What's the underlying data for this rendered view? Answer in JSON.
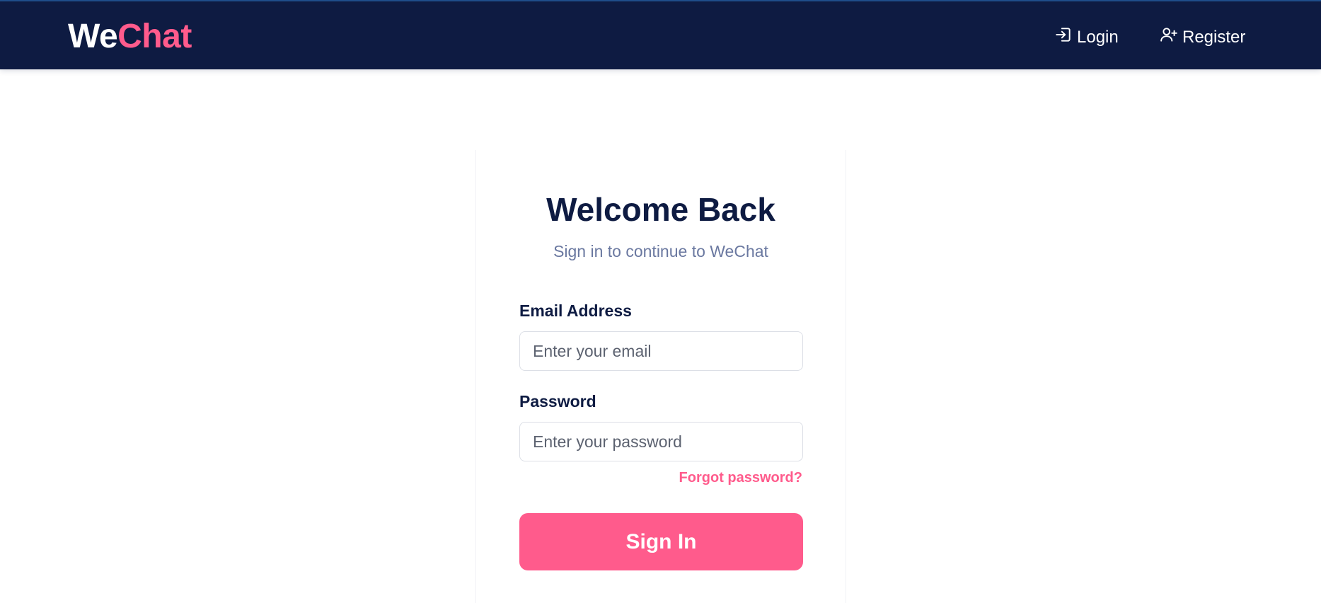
{
  "header": {
    "logo_part1": "We",
    "logo_part2": "Chat",
    "nav": {
      "login_label": "Login",
      "login_icon": "login-icon",
      "register_label": "Register",
      "register_icon": "user-plus-icon"
    }
  },
  "form": {
    "title": "Welcome Back",
    "subtitle": "Sign in to continue to WeChat",
    "email_label": "Email Address",
    "email_placeholder": "Enter your email",
    "email_value": "",
    "password_label": "Password",
    "password_placeholder": "Enter your password",
    "password_value": "",
    "forgot_label": "Forgot password?",
    "submit_label": "Sign In"
  },
  "colors": {
    "header_bg": "#0e1b42",
    "accent": "#ff5b8c",
    "title": "#0e1b42",
    "subtitle": "#6a78a0"
  }
}
